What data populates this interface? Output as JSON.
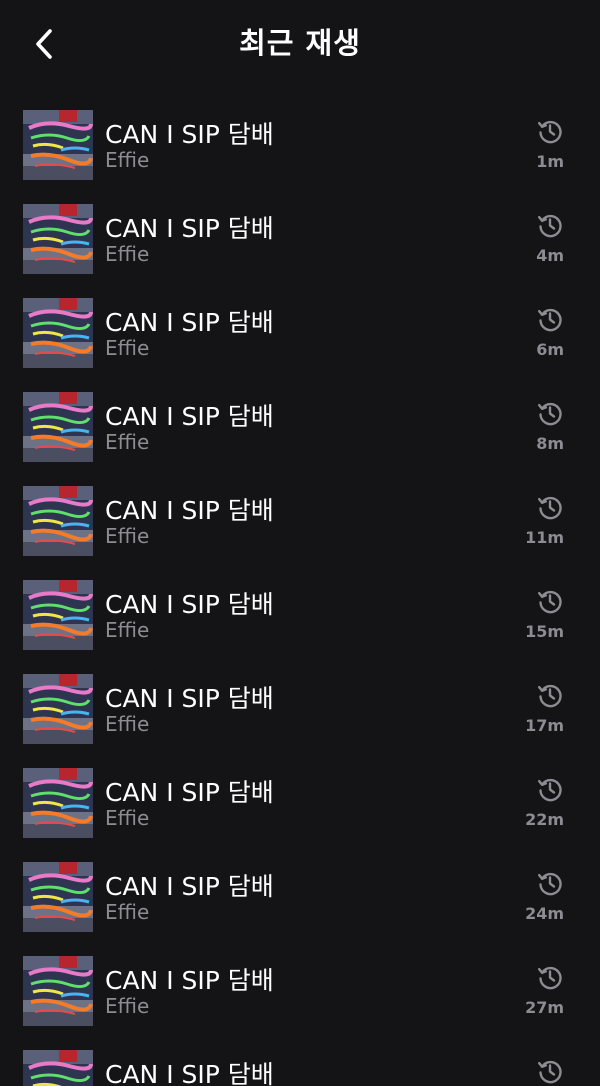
{
  "header": {
    "title": "최근 재생",
    "back_icon": "chevron-left-icon"
  },
  "colors": {
    "background": "#141416",
    "primary_text": "#ffffff",
    "secondary_text": "#8c8c92"
  },
  "recent_items": [
    {
      "title": "CAN I SIP 담배",
      "artist": "Effie",
      "played_ago": "1m"
    },
    {
      "title": "CAN I SIP 담배",
      "artist": "Effie",
      "played_ago": "4m"
    },
    {
      "title": "CAN I SIP 담배",
      "artist": "Effie",
      "played_ago": "6m"
    },
    {
      "title": "CAN I SIP 담배",
      "artist": "Effie",
      "played_ago": "8m"
    },
    {
      "title": "CAN I SIP 담배",
      "artist": "Effie",
      "played_ago": "11m"
    },
    {
      "title": "CAN I SIP 담배",
      "artist": "Effie",
      "played_ago": "15m"
    },
    {
      "title": "CAN I SIP 담배",
      "artist": "Effie",
      "played_ago": "17m"
    },
    {
      "title": "CAN I SIP 담배",
      "artist": "Effie",
      "played_ago": "22m"
    },
    {
      "title": "CAN I SIP 담배",
      "artist": "Effie",
      "played_ago": "24m"
    },
    {
      "title": "CAN I SIP 담배",
      "artist": "Effie",
      "played_ago": "27m"
    },
    {
      "title": "CAN I SIP 담배",
      "artist": "",
      "played_ago": ""
    }
  ],
  "item_icon": "history-clock-icon"
}
